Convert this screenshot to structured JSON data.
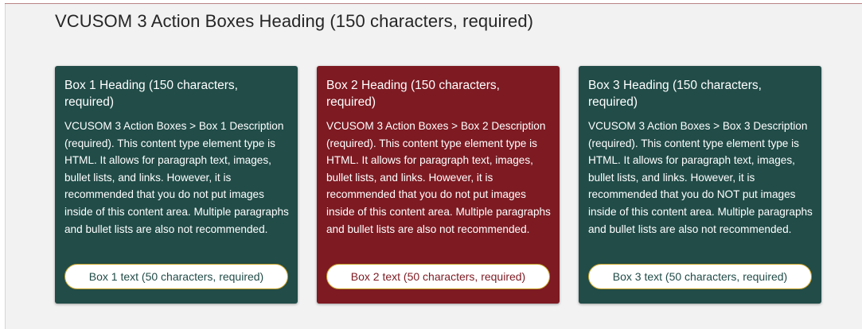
{
  "section": {
    "heading": "VCUSOM 3 Action Boxes Heading (150 characters, required)"
  },
  "colors": {
    "green_box": "#214c48",
    "red_box": "#7d1a22",
    "panel_bg": "#f2f2f2",
    "button_border": "#c9a227"
  },
  "boxes": [
    {
      "title": "Box 1 Heading (150 characters, required)",
      "description": "VCUSOM 3 Action Boxes > Box 1 Description (required). This content type element type is HTML. It allows for paragraph text, images, bullet lists, and links. However, it is recommended that you do not put images inside of this content area. Multiple paragraphs and bullet lists are also not recommended.",
      "button_label": "Box 1 text (50 characters, required)",
      "color": "#214c48"
    },
    {
      "title": "Box 2 Heading (150 characters, required)",
      "description": "VCUSOM 3 Action Boxes > Box 2 Description (required). This content type element type is HTML. It allows for paragraph text, images, bullet lists, and links. However, it is recommended that you do not put images inside of this content area. Multiple paragraphs and bullet lists are also not recommended.",
      "button_label": "Box 2 text (50 characters, required)",
      "color": "#7d1a22"
    },
    {
      "title": "Box 3 Heading (150 characters, required)",
      "description": "VCUSOM 3 Action Boxes > Box 3 Description (required). This content type element type is HTML. It allows for paragraph text, images, bullet lists, and links. However, it is recommended that you do NOT put images inside of this content area. Multiple paragraphs and bullet lists are also not recommended.",
      "button_label": "Box 3 text (50 characters, required)",
      "color": "#214c48"
    }
  ]
}
